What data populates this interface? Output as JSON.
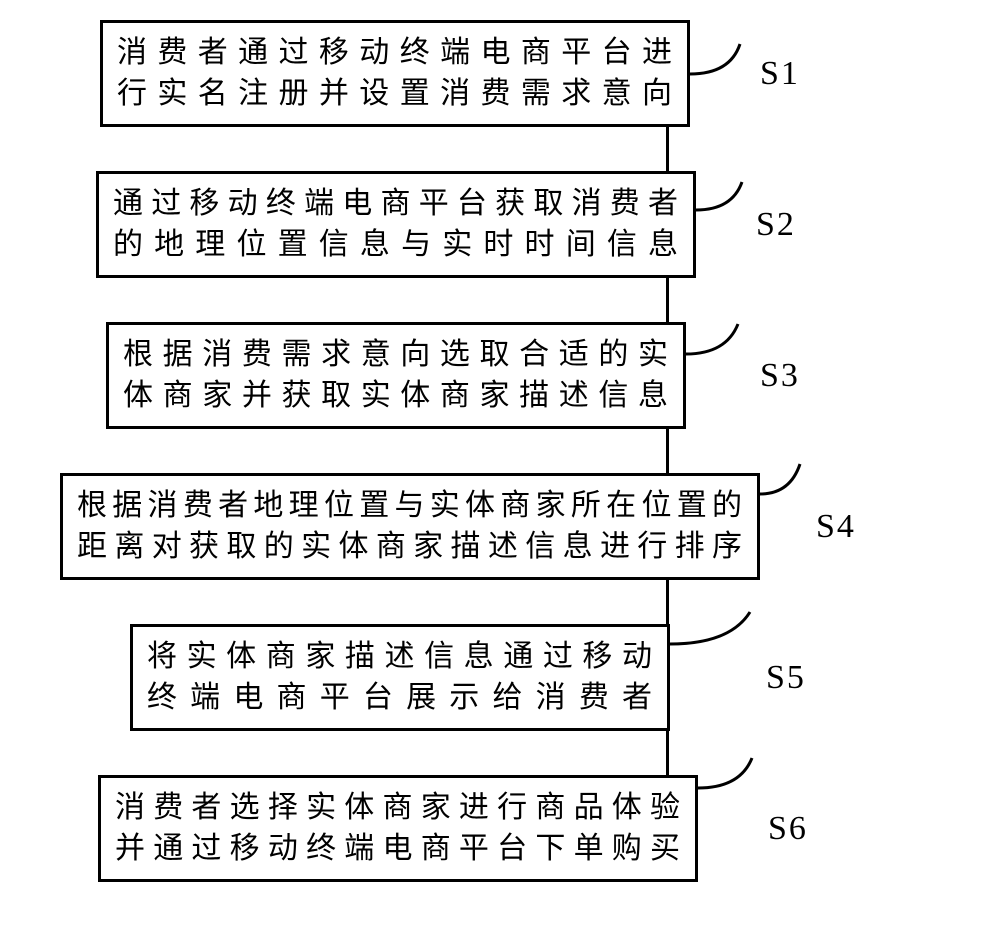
{
  "diagram": {
    "type": "flowchart",
    "direction": "top-to-bottom",
    "steps": [
      {
        "id": "S1",
        "label": "S1",
        "line1": "消费者通过移动终端电商平台进",
        "line2": "行实名注册并设置消费需求意向"
      },
      {
        "id": "S2",
        "label": "S2",
        "line1": "通过移动终端电商平台获取消费者",
        "line2": "的地理位置信息与实时时间信息"
      },
      {
        "id": "S3",
        "label": "S3",
        "line1": "根据消费需求意向选取合适的实",
        "line2": "体商家并获取实体商家描述信息"
      },
      {
        "id": "S4",
        "label": "S4",
        "line1": "根据消费者地理位置与实体商家所在位置的",
        "line2": "距离对获取的实体商家描述信息进行排序"
      },
      {
        "id": "S5",
        "label": "S5",
        "line1": "将实体商家描述信息通过移动",
        "line2": "终端电商平台展示给消费者"
      },
      {
        "id": "S6",
        "label": "S6",
        "line1": "消费者选择实体商家进行商品体验",
        "line2": "并通过移动终端电商平台下单购买"
      }
    ]
  }
}
